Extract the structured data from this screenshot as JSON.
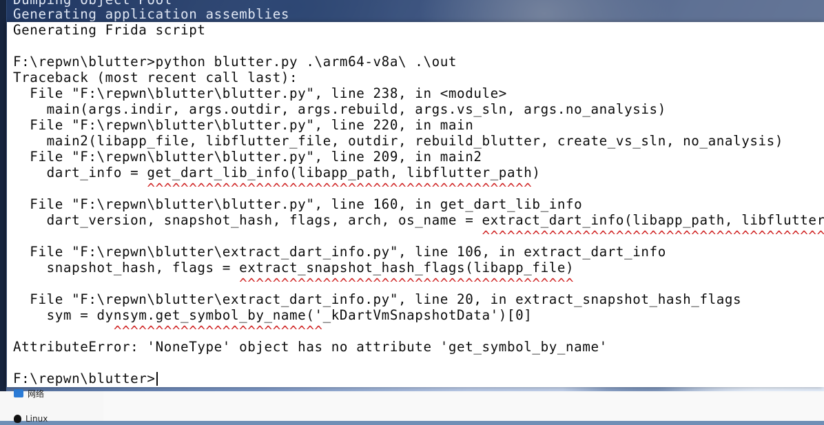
{
  "scrolled_lines": [
    "Dumping Object Pool",
    "Generating application assemblies"
  ],
  "console_lines": [
    "Generating Frida script",
    "",
    "F:\\repwn\\blutter>python blutter.py .\\arm64-v8a\\ .\\out",
    "Traceback (most recent call last):",
    "  File \"F:\\repwn\\blutter\\blutter.py\", line 238, in <module>",
    "    main(args.indir, args.outdir, args.rebuild, args.vs_sln, args.no_analysis)",
    "  File \"F:\\repwn\\blutter\\blutter.py\", line 220, in main",
    "    main2(libapp_file, libflutter_file, outdir, rebuild_blutter, create_vs_sln, no_analysis)",
    "  File \"F:\\repwn\\blutter\\blutter.py\", line 209, in main2",
    "    dart_info = get_dart_lib_info(libapp_path, libflutter_path)",
    "                ^^^^^^^^^^^^^^^^^^^^^^^^^^^^^^^^^^^^^^^^^^^^^^",
    "  File \"F:\\repwn\\blutter\\blutter.py\", line 160, in get_dart_lib_info",
    "    dart_version, snapshot_hash, flags, arch, os_name = extract_dart_info(libapp_path, libflutter_",
    "                                                        ^^^^^^^^^^^^^^^^^^^^^^^^^^^^^^^^^^^^^^^^^",
    "  File \"F:\\repwn\\blutter\\extract_dart_info.py\", line 106, in extract_dart_info",
    "    snapshot_hash, flags = extract_snapshot_hash_flags(libapp_file)",
    "                           ^^^^^^^^^^^^^^^^^^^^^^^^^^^^^^^^^^^^^^^^",
    "  File \"F:\\repwn\\blutter\\extract_dart_info.py\", line 20, in extract_snapshot_hash_flags",
    "    sym = dynsym.get_symbol_by_name('_kDartVmSnapshotData')[0]",
    "            ^^^^^^^^^^^^^^^^^^^^^^^^^",
    "AttributeError: 'NoneType' object has no attribute 'get_symbol_by_name'",
    "",
    "F:\\repwn\\blutter>"
  ],
  "explorer_nav": [
    "网络",
    "Linux"
  ],
  "icons": {
    "network": "network-icon",
    "linux": "linux-penguin-icon"
  }
}
